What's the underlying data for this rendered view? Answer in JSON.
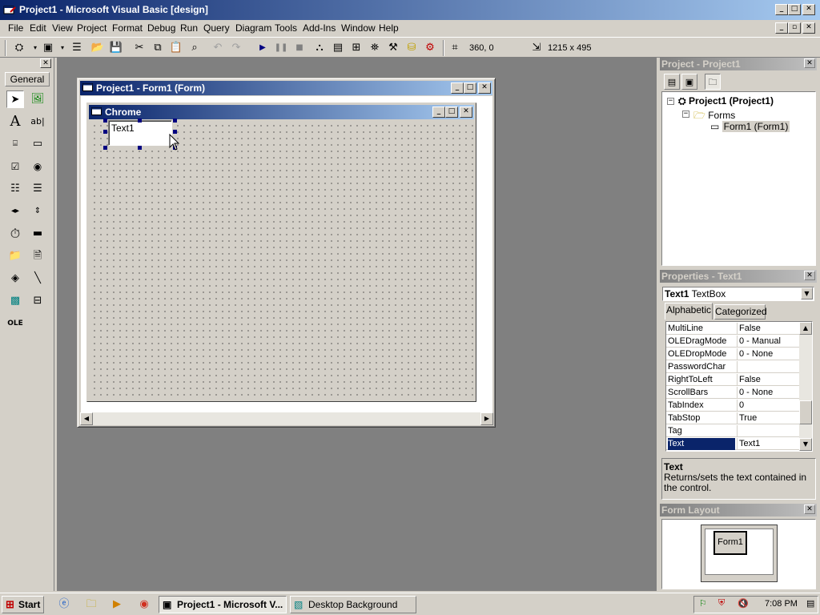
{
  "app": {
    "title": "Project1 - Microsoft Visual Basic [design]"
  },
  "menu": [
    "File",
    "Edit",
    "View",
    "Project",
    "Format",
    "Debug",
    "Run",
    "Query",
    "Diagram",
    "Tools",
    "Add-Ins",
    "Window",
    "Help"
  ],
  "toolbar": {
    "position": "360, 0",
    "size": "1215 x 495"
  },
  "toolbox": {
    "tab_label": "General"
  },
  "form_window": {
    "title": "Project1 - Form1 (Form)"
  },
  "design_form": {
    "caption": "Chrome",
    "textbox_text": "Text1"
  },
  "project_panel": {
    "title": "Project - Project1",
    "tree": {
      "root": "Project1 (Project1)",
      "folder": "Forms",
      "item": "Form1 (Form1)"
    }
  },
  "properties_panel": {
    "title": "Properties - Text1",
    "object_name": "Text1",
    "object_type": "TextBox",
    "tabs": [
      "Alphabetic",
      "Categorized"
    ],
    "rows": [
      {
        "name": "MultiLine",
        "value": "False"
      },
      {
        "name": "OLEDragMode",
        "value": "0 - Manual"
      },
      {
        "name": "OLEDropMode",
        "value": "0 - None"
      },
      {
        "name": "PasswordChar",
        "value": ""
      },
      {
        "name": "RightToLeft",
        "value": "False"
      },
      {
        "name": "ScrollBars",
        "value": "0 - None"
      },
      {
        "name": "TabIndex",
        "value": "0"
      },
      {
        "name": "TabStop",
        "value": "True"
      },
      {
        "name": "Tag",
        "value": ""
      },
      {
        "name": "Text",
        "value": "Text1"
      }
    ],
    "selected_row": 9,
    "description_title": "Text",
    "description_text": "Returns/sets the text contained in the control."
  },
  "layout_panel": {
    "title": "Form Layout",
    "form_label": "Form1"
  },
  "taskbar": {
    "start_label": "Start",
    "tasks": [
      "Project1 - Microsoft V...",
      "Desktop Background"
    ],
    "clock": "7:08 PM"
  },
  "colors": {
    "title_active": "#0a246a",
    "title_inactive": "#808080",
    "selection": "#0a246a",
    "mdi_background": "#808080"
  }
}
